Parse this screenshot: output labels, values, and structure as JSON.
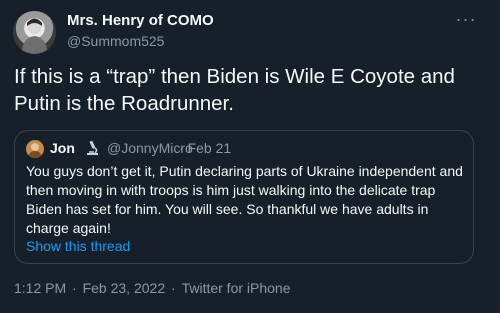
{
  "author": {
    "display_name": "Mrs. Henry of COMO",
    "handle": "@Summom525",
    "avatar_icon": "profile-photo-avatar"
  },
  "more_icon": "ellipsis-icon",
  "more_label": "···",
  "tweet": {
    "text": "If this is a “trap” then Biden is Wile E Coyote and Putin is the Roadrunner."
  },
  "quoted": {
    "name": "Jon",
    "badge_icon": "microscope-icon",
    "handle": "@JonnyMicro",
    "date": "· Feb 21",
    "text": "You guys don’t get it, Putin declaring parts of Ukraine independent and then moving in with troops is him just walking into the delicate trap Biden has set for him. You will see. So thankful we have adults in charge again!",
    "show_thread": "Show this thread"
  },
  "meta": {
    "time": "1:12 PM",
    "separator": "·",
    "date": "Feb 23, 2022",
    "source": "Twitter for iPhone"
  },
  "colors": {
    "background": "#15202b",
    "primary_text": "#f7f9f9",
    "secondary_text": "#8b98a5",
    "link": "#1d9bf0",
    "border": "#38444d"
  }
}
